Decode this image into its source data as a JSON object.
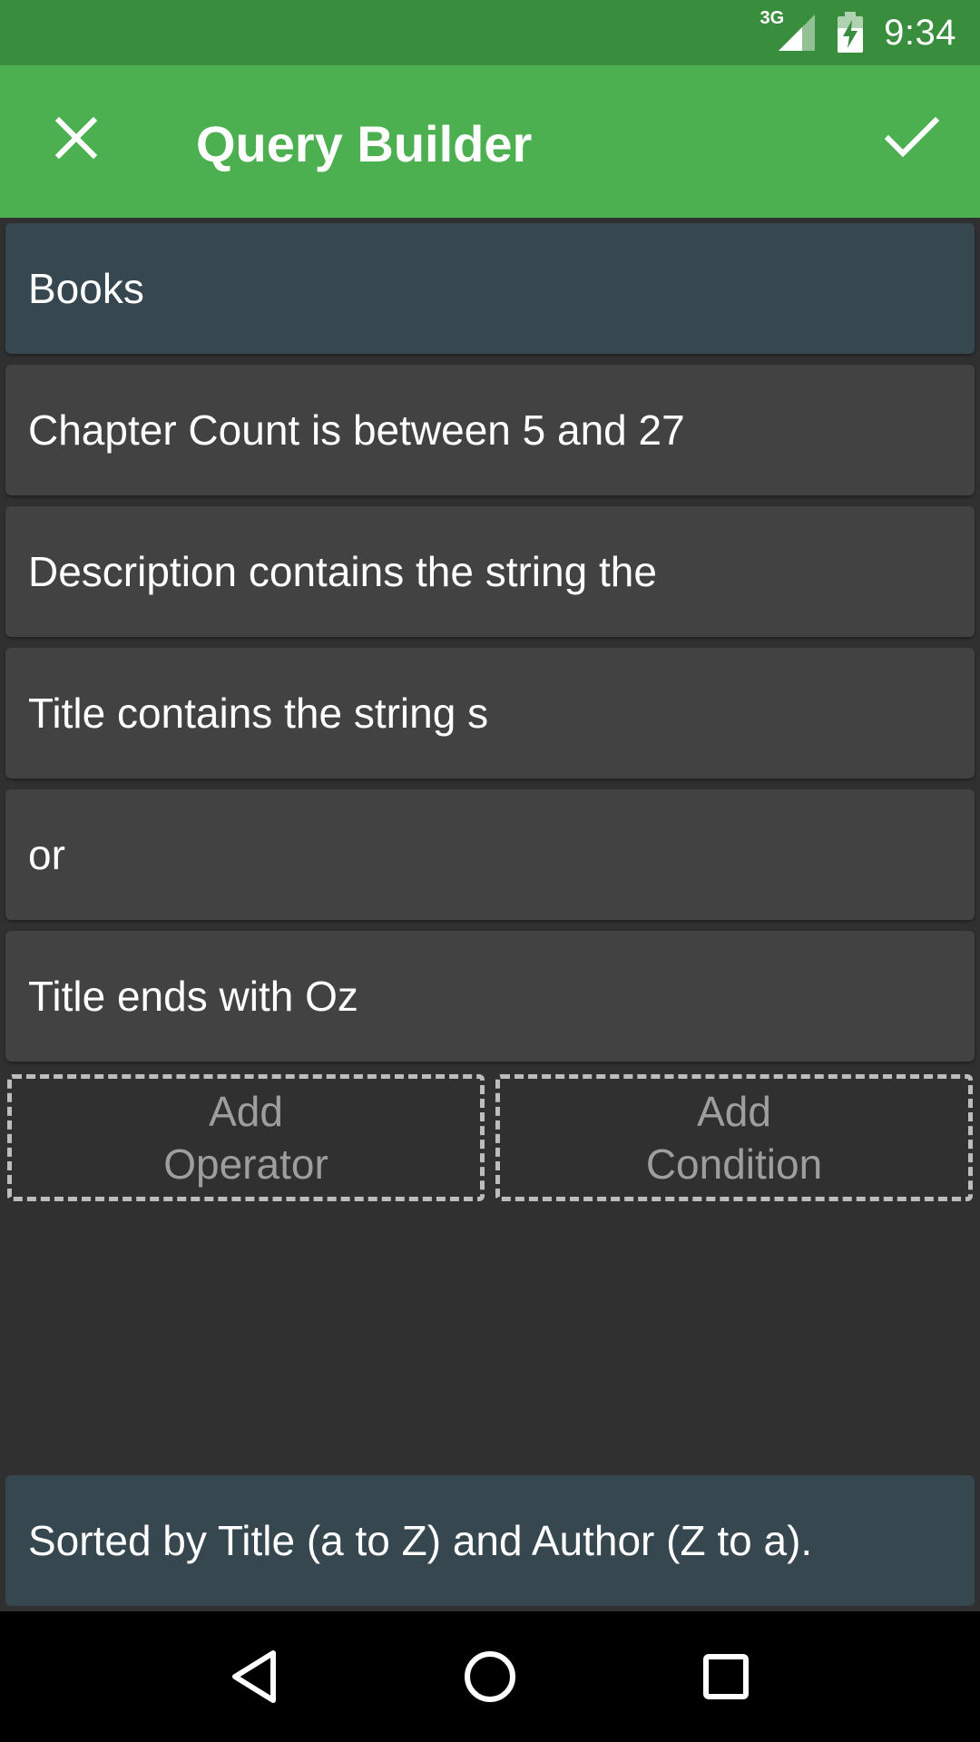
{
  "status_bar": {
    "network": "3G",
    "time": "9:34",
    "icons": [
      "signal-icon",
      "battery-charging-icon"
    ]
  },
  "app_bar": {
    "title": "Query Builder",
    "close_icon": "close-icon",
    "done_icon": "check-icon"
  },
  "query": {
    "table": "Books",
    "items": [
      {
        "label": "Chapter Count is between 5 and 27"
      },
      {
        "label": "Description contains the string the"
      },
      {
        "label": "Title contains the string s"
      },
      {
        "label": "or"
      },
      {
        "label": "Title ends with Oz"
      }
    ]
  },
  "actions": {
    "add_operator": "Add\nOperator",
    "add_condition": "Add\nCondition"
  },
  "sort": {
    "label": "Sorted by Title (a to Z) and Author (Z to a)."
  },
  "nav_bar": {
    "icons": [
      "back-icon",
      "home-icon",
      "recents-icon"
    ]
  },
  "colors": {
    "status_bar": "#388e3c",
    "app_bar": "#4caf50",
    "background": "#303030",
    "card": "#424242",
    "accent_card": "#37474f"
  }
}
